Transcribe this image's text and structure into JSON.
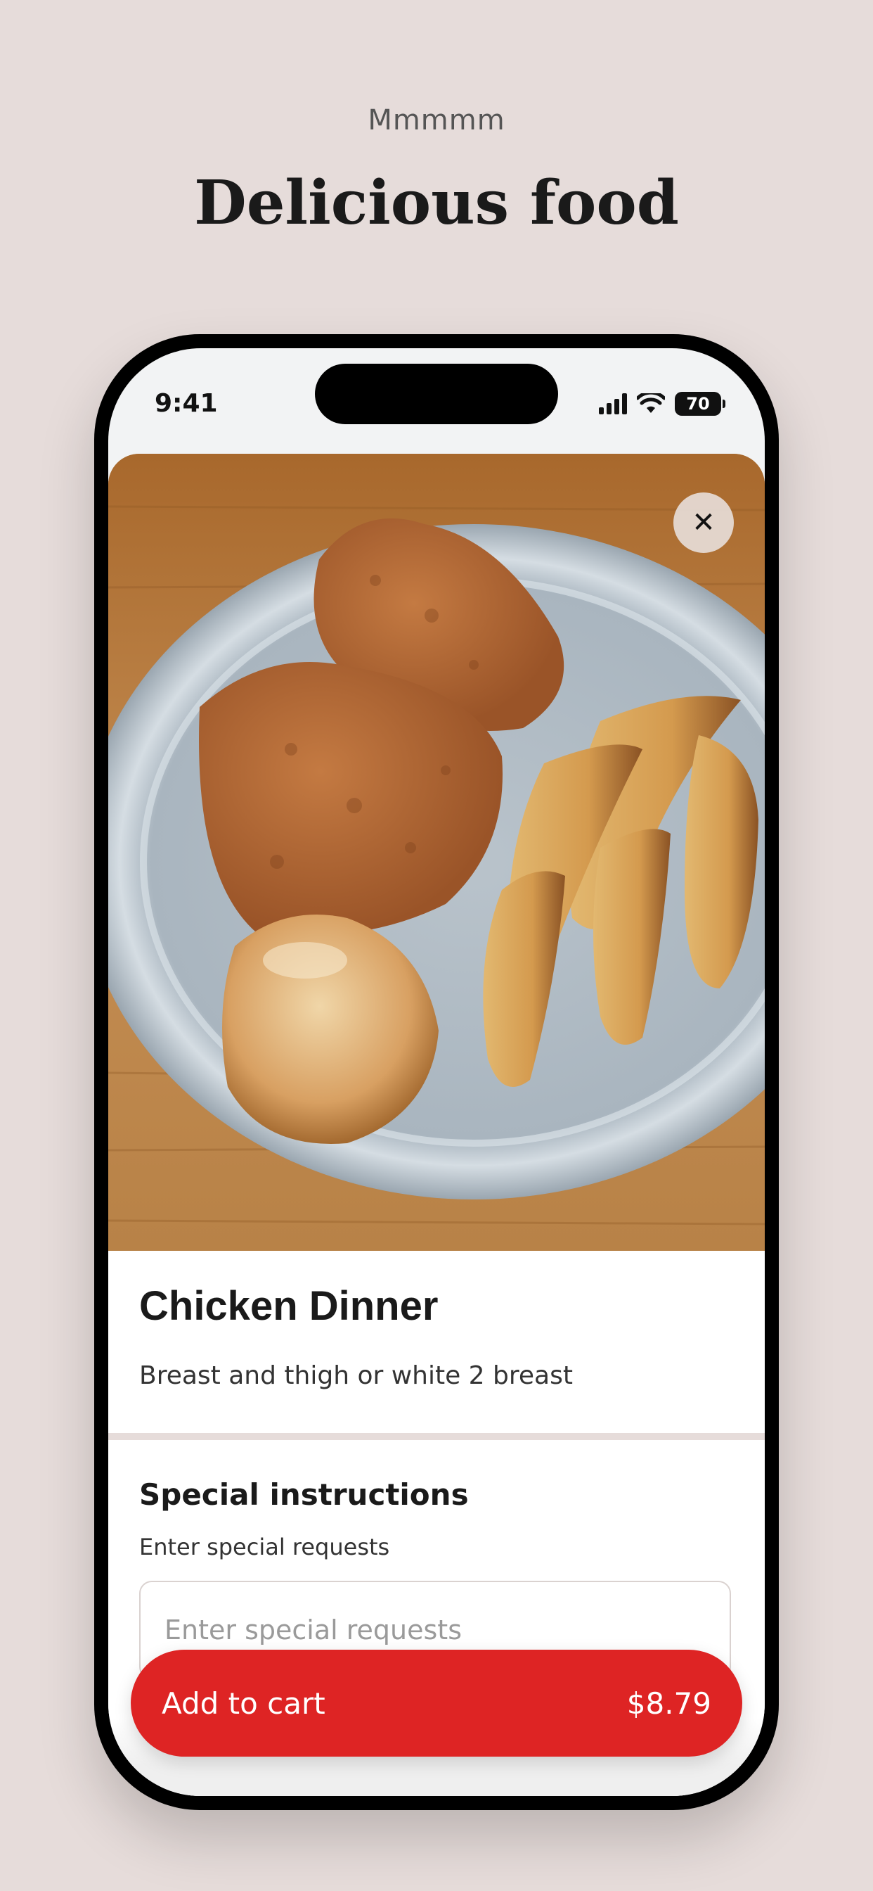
{
  "header": {
    "eyebrow": "Mmmmm",
    "headline": "Delicious food"
  },
  "status_bar": {
    "time": "9:41",
    "battery": "70"
  },
  "item": {
    "image_alt": "Fried chicken breast and thigh with potato wedges and a roll on a metal plate",
    "name": "Chicken Dinner",
    "description": "Breast and thigh or white 2 breast"
  },
  "special_instructions": {
    "title": "Special instructions",
    "subtitle": "Enter special requests",
    "placeholder": "Enter special requests",
    "value": ""
  },
  "cart_button": {
    "label": "Add to cart",
    "price": "$8.79"
  },
  "colors": {
    "background": "#e6dcda",
    "accent": "#de2424",
    "text": "#1a1a1a"
  }
}
